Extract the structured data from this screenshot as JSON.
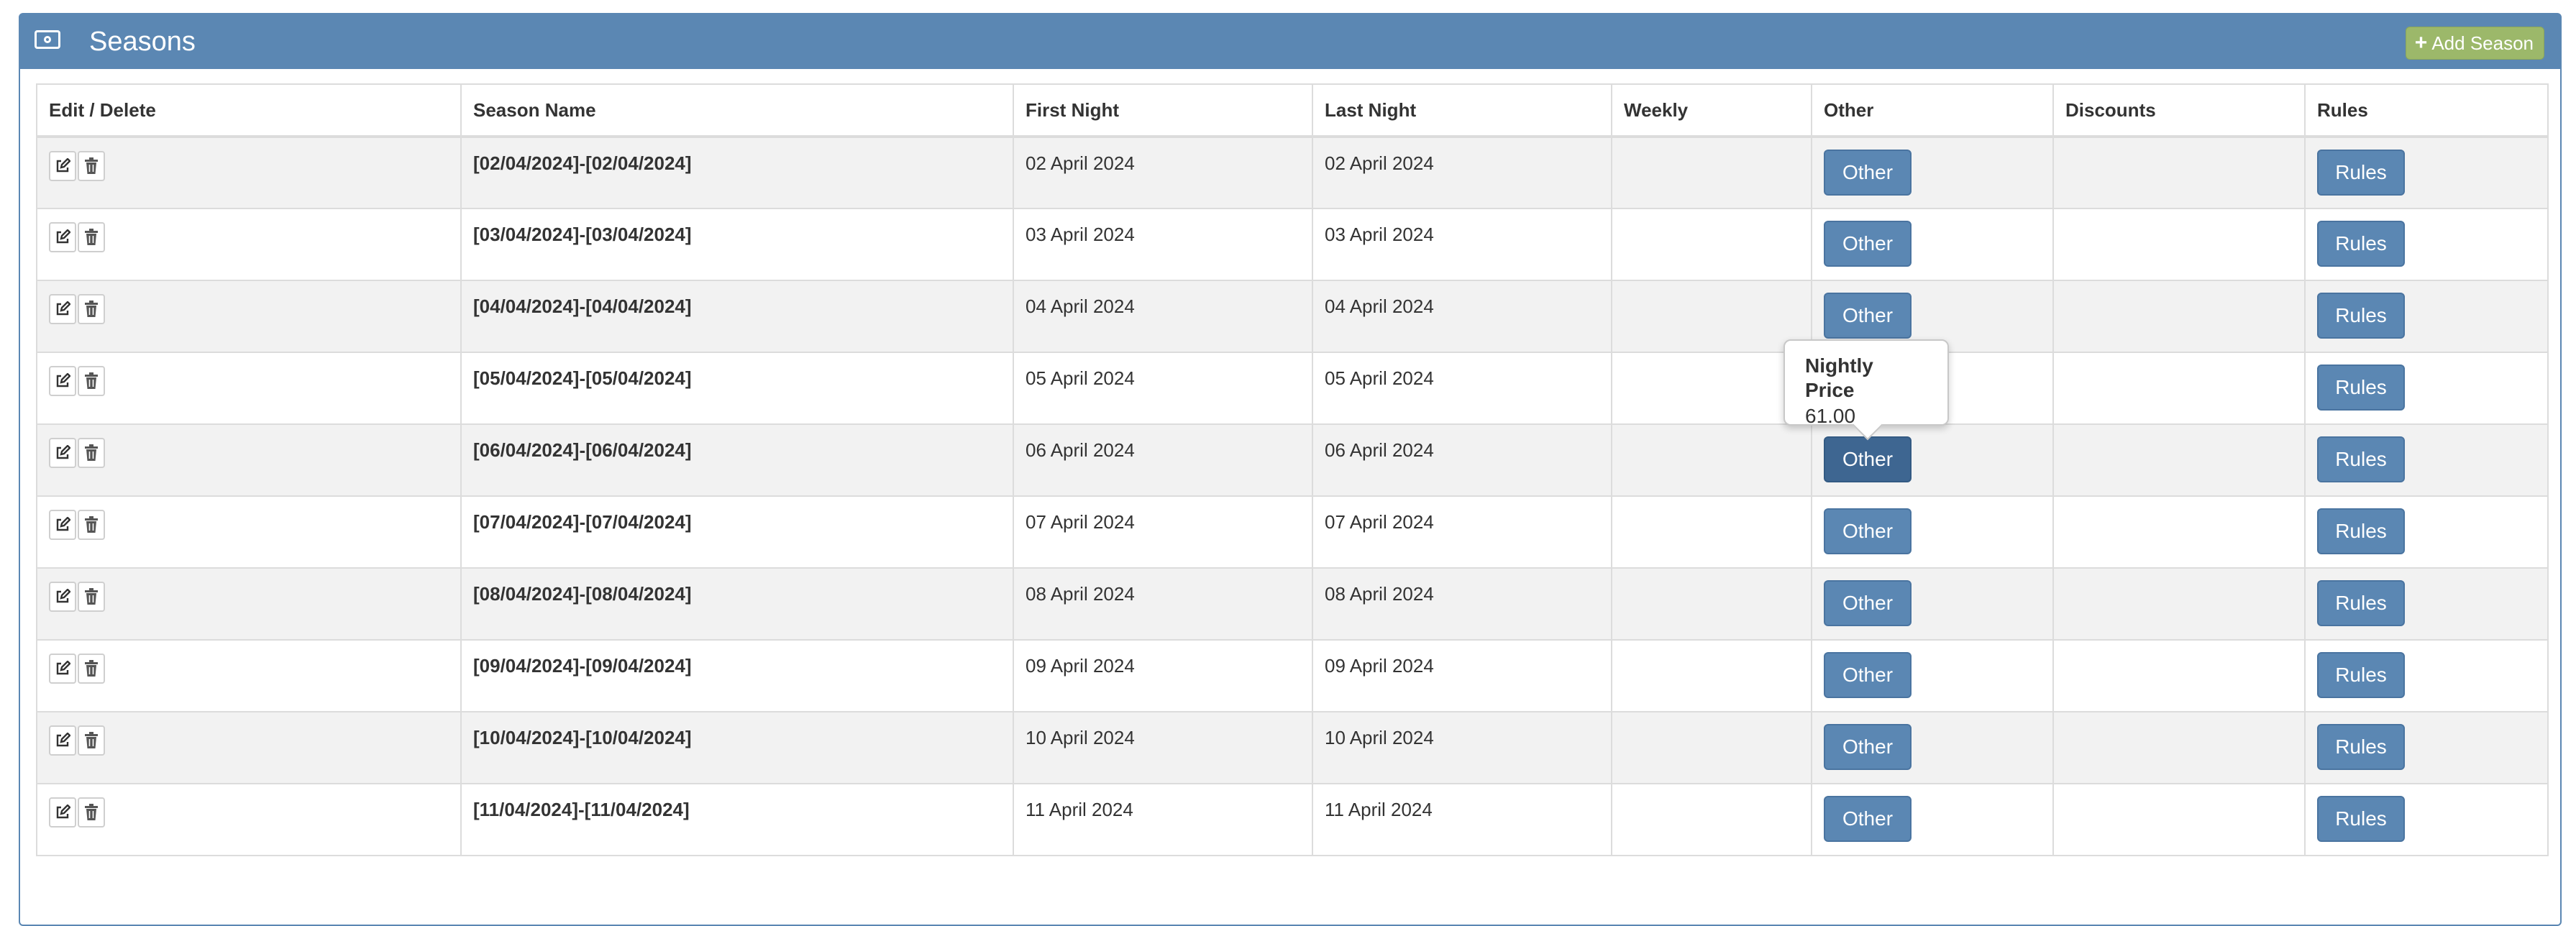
{
  "panel": {
    "title": "Seasons",
    "add_label": "Add Season",
    "accent_color": "#5b87b3",
    "add_color": "#9cb86a"
  },
  "table": {
    "headers": [
      "Edit / Delete",
      "Season Name",
      "First Night",
      "Last Night",
      "Weekly",
      "Other",
      "Discounts",
      "Rules"
    ],
    "other_label": "Other",
    "rules_label": "Rules",
    "rows": [
      {
        "name": "[02/04/2024]-[02/04/2024]",
        "first": "02 April 2024",
        "last": "02 April 2024",
        "weekly": "",
        "discounts": ""
      },
      {
        "name": "[03/04/2024]-[03/04/2024]",
        "first": "03 April 2024",
        "last": "03 April 2024",
        "weekly": "",
        "discounts": ""
      },
      {
        "name": "[04/04/2024]-[04/04/2024]",
        "first": "04 April 2024",
        "last": "04 April 2024",
        "weekly": "",
        "discounts": ""
      },
      {
        "name": "[05/04/2024]-[05/04/2024]",
        "first": "05 April 2024",
        "last": "05 April 2024",
        "weekly": "",
        "discounts": ""
      },
      {
        "name": "[06/04/2024]-[06/04/2024]",
        "first": "06 April 2024",
        "last": "06 April 2024",
        "weekly": "",
        "discounts": ""
      },
      {
        "name": "[07/04/2024]-[07/04/2024]",
        "first": "07 April 2024",
        "last": "07 April 2024",
        "weekly": "",
        "discounts": ""
      },
      {
        "name": "[08/04/2024]-[08/04/2024]",
        "first": "08 April 2024",
        "last": "08 April 2024",
        "weekly": "",
        "discounts": ""
      },
      {
        "name": "[09/04/2024]-[09/04/2024]",
        "first": "09 April 2024",
        "last": "09 April 2024",
        "weekly": "",
        "discounts": ""
      },
      {
        "name": "[10/04/2024]-[10/04/2024]",
        "first": "10 April 2024",
        "last": "10 April 2024",
        "weekly": "",
        "discounts": ""
      },
      {
        "name": "[11/04/2024]-[11/04/2024]",
        "first": "11 April 2024",
        "last": "11 April 2024",
        "weekly": "",
        "discounts": ""
      }
    ]
  },
  "tooltip": {
    "title": "Nightly Price",
    "value": "61.00"
  },
  "icons": {
    "panel": "money-icon",
    "add": "plus-icon",
    "edit": "edit-icon",
    "delete": "trash-icon"
  }
}
